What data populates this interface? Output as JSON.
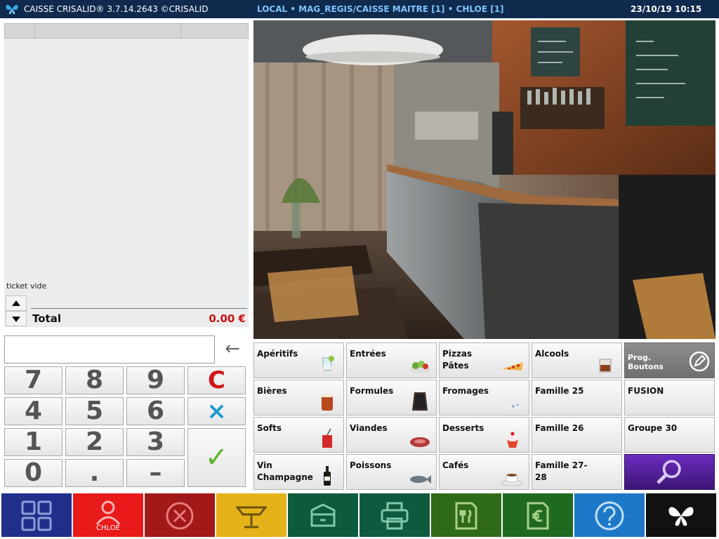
{
  "titlebar": {
    "app_name": "CAISSE CRISALID® 3.7.14.2643 ©CRISALID",
    "context": "LOCAL  • MAG_REGIS/CAISSE MAITRE [1] • CHLOE [1]",
    "datetime": "23/10/19  10:15"
  },
  "ticket": {
    "empty_text": "ticket vide",
    "total_label": "Total",
    "total_value": "0.00 €"
  },
  "keypad": {
    "entry_value": "",
    "backspace_icon": "←",
    "keys": [
      "7",
      "8",
      "9",
      "C",
      "4",
      "5",
      "6",
      "×",
      "1",
      "2",
      "3",
      "✓",
      "0",
      ".",
      "–"
    ]
  },
  "categories": [
    {
      "label": "Apéritifs",
      "icon": "cocktail-icon"
    },
    {
      "label": "Entrées",
      "icon": "salad-icon"
    },
    {
      "label": "Pizzas\nPâtes",
      "icon": "pizza-icon"
    },
    {
      "label": "Alcools",
      "icon": "whisky-icon"
    },
    {
      "label": "Prog.\nBoutons",
      "icon": "pencil-icon"
    },
    {
      "label": "Bières",
      "icon": "beer-icon"
    },
    {
      "label": "Formules",
      "icon": "chalkboard-icon"
    },
    {
      "label": "Fromages",
      "icon": "cheese-icon"
    },
    {
      "label": "Famille 25",
      "icon": ""
    },
    {
      "label": "FUSION",
      "icon": ""
    },
    {
      "label": "Softs",
      "icon": "soda-icon"
    },
    {
      "label": "Viandes",
      "icon": "meat-icon"
    },
    {
      "label": "Desserts",
      "icon": "cupcake-icon"
    },
    {
      "label": "Famille 26",
      "icon": ""
    },
    {
      "label": "Groupe 30",
      "icon": ""
    },
    {
      "label": "Vin\nChampagne",
      "icon": "wine-bottle-icon"
    },
    {
      "label": "Poissons",
      "icon": "fish-icon"
    },
    {
      "label": "Cafés",
      "icon": "coffee-cup-icon"
    },
    {
      "label": "Famille 27-28",
      "icon": ""
    },
    {
      "label": "",
      "icon": "magnifier-icon"
    }
  ],
  "toolbar": {
    "user_label": "CHLOE",
    "buttons": [
      {
        "icon": "grid-icon",
        "color": "#1f2f8a"
      },
      {
        "icon": "user-icon",
        "color": "#e81a1a"
      },
      {
        "icon": "cancel-icon",
        "color": "#a11919"
      },
      {
        "icon": "table-icon",
        "color": "#e6b21a"
      },
      {
        "icon": "cash-drawer-icon",
        "color": "#0d5a3c"
      },
      {
        "icon": "printer-icon",
        "color": "#0f5a3f"
      },
      {
        "icon": "receipt-fork-icon",
        "color": "#2f6a18"
      },
      {
        "icon": "euro-receipt-icon",
        "color": "#1f6a20"
      },
      {
        "icon": "help-icon",
        "color": "#1e78c8"
      },
      {
        "icon": "butterfly-logo-icon",
        "color": "#111111"
      }
    ]
  },
  "colors": {
    "titlebar_bg": "#0f2a4d",
    "context_text": "#7ec3ff",
    "total_value": "#cc1010"
  }
}
